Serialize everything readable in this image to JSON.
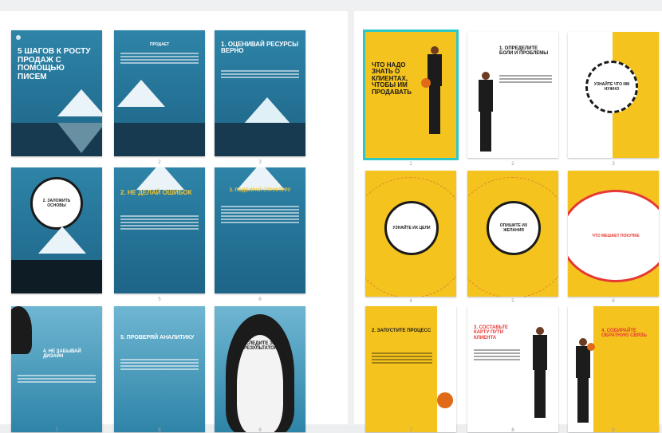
{
  "slides_left": [
    {
      "title": "5 ШАГОВ К РОСТУ ПРОДАЖ С ПОМОЩЬЮ ПИСЕМ",
      "page": ""
    },
    {
      "title": "ПРОДАЕТ",
      "page": "2"
    },
    {
      "title": "1. ОЦЕНИВАЙ РЕСУРСЫ ВЕРНО",
      "page": "3"
    },
    {
      "title": "2. ЗАЛОЖИТЬ ОСНОВЫ",
      "page": ""
    },
    {
      "title": "2. НЕ ДЕЛАЙ ОШИБОК",
      "page": "5"
    },
    {
      "title": "3. ПОДБИРАЙ СТРУКТУРУ",
      "page": "6"
    },
    {
      "title": "4. НЕ ЗАБЫВАЙ ДИЗАЙН",
      "page": "7"
    },
    {
      "title": "5. ПРОВЕРЯЙ АНАЛИТИКУ",
      "page": "8"
    },
    {
      "title": "СЛЕДИТЕ ЗА РЕЗУЛЬТАТОМ",
      "page": "9"
    }
  ],
  "slides_right": [
    {
      "title": "ЧТО НАДО ЗНАТЬ О КЛИЕНТАХ, ЧТОБЫ ИМ ПРОДАВАТЬ",
      "page": "1"
    },
    {
      "title": "1. ОПРЕДЕЛИТЕ БОЛИ И ПРОБЛЕМЫ",
      "page": "2"
    },
    {
      "title": "УЗНАЙТЕ ЧТО ИМ НУЖНО",
      "page": "3"
    },
    {
      "title": "УЗНАЙТЕ ИХ ЦЕЛИ",
      "page": "4"
    },
    {
      "title": "ОПИШИТЕ ИХ ЖЕЛАНИЯ",
      "page": "5"
    },
    {
      "title": "ЧТО МЕШАЕТ ПОКУПКЕ",
      "page": "6"
    },
    {
      "title": "2. ЗАПУСТИТЕ ПРОЦЕСС",
      "page": "7"
    },
    {
      "title": "3. СОСТАВЬТЕ КАРТУ ПУТИ КЛИЕНТА",
      "page": "8"
    },
    {
      "title": "4. СОБИРАЙТЕ ОБРАТНУЮ СВЯЗЬ",
      "page": "9"
    }
  ],
  "colors": {
    "accent": "#2fc6c6",
    "yellow": "#f5c31e",
    "blue": "#2e84a8",
    "red": "#e53935"
  }
}
